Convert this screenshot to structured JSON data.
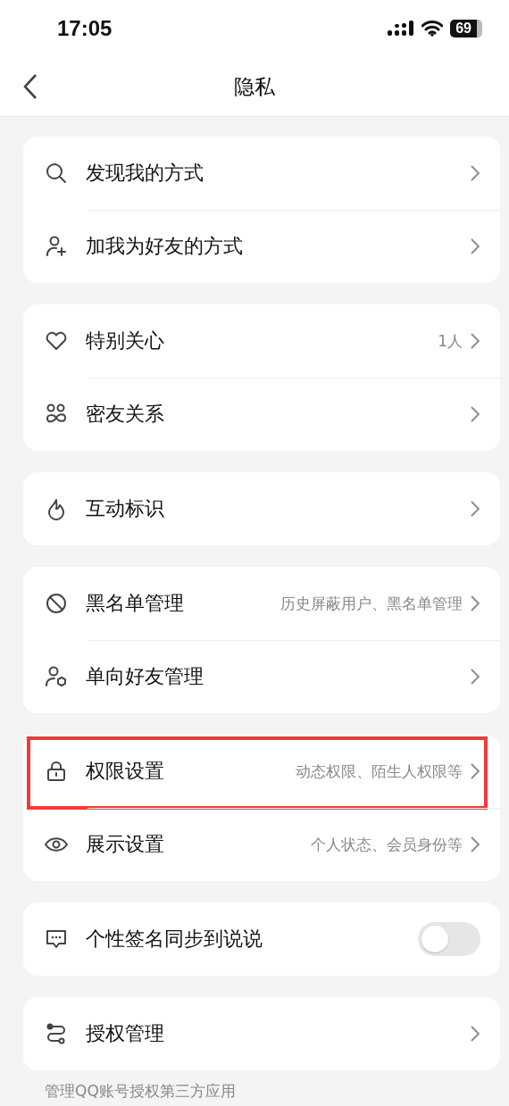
{
  "status_bar": {
    "time": "17:05",
    "battery": "69"
  },
  "nav": {
    "title": "隐私"
  },
  "groups": [
    {
      "items": [
        {
          "label": "发现我的方式",
          "kind": "link",
          "highlighted": false
        },
        {
          "label": "加我为好友的方式",
          "kind": "link",
          "highlighted": false
        }
      ]
    },
    {
      "items": [
        {
          "label": "特别关心",
          "value": "1人",
          "kind": "link",
          "highlighted": false
        },
        {
          "label": "密友关系",
          "kind": "link",
          "highlighted": false
        }
      ]
    },
    {
      "items": [
        {
          "label": "互动标识",
          "kind": "link",
          "highlighted": false
        }
      ]
    },
    {
      "items": [
        {
          "label": "黑名单管理",
          "value": "历史屏蔽用户、黑名单管理",
          "kind": "link",
          "highlighted": false
        },
        {
          "label": "单向好友管理",
          "kind": "link",
          "highlighted": false
        }
      ]
    },
    {
      "items": [
        {
          "label": "权限设置",
          "value": "动态权限、陌生人权限等",
          "kind": "link",
          "highlighted": true
        },
        {
          "label": "展示设置",
          "value": "个人状态、会员身份等",
          "kind": "link",
          "highlighted": false
        }
      ]
    },
    {
      "items": [
        {
          "label": "个性签名同步到说说",
          "kind": "toggle",
          "on": false,
          "highlighted": false
        }
      ]
    },
    {
      "items": [
        {
          "label": "授权管理",
          "kind": "link",
          "highlighted": false
        }
      ]
    }
  ],
  "footer_note": "管理QQ账号授权第三方应用"
}
